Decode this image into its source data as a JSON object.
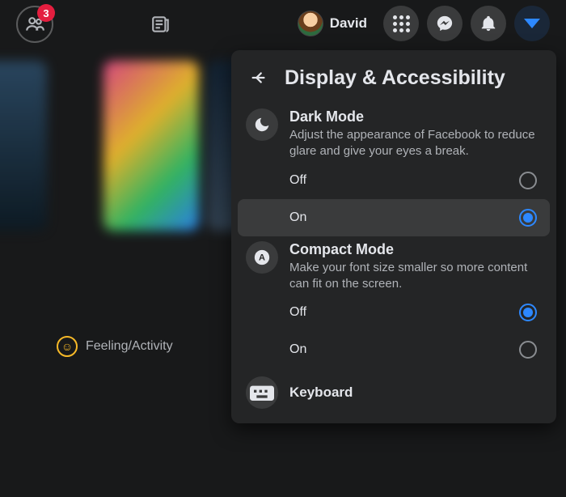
{
  "topbar": {
    "friends_badge": "3",
    "profile_name": "David"
  },
  "panel": {
    "title": "Display & Accessibility",
    "dark_mode": {
      "title": "Dark Mode",
      "desc": "Adjust the appearance of Facebook to reduce glare and give your eyes a break.",
      "off_label": "Off",
      "on_label": "On",
      "value": "on"
    },
    "compact_mode": {
      "title": "Compact Mode",
      "desc": "Make your font size smaller so more content can fit on the screen.",
      "off_label": "Off",
      "on_label": "On",
      "value": "off"
    },
    "keyboard_label": "Keyboard"
  },
  "composer": {
    "feeling_label": "Feeling/Activity"
  }
}
